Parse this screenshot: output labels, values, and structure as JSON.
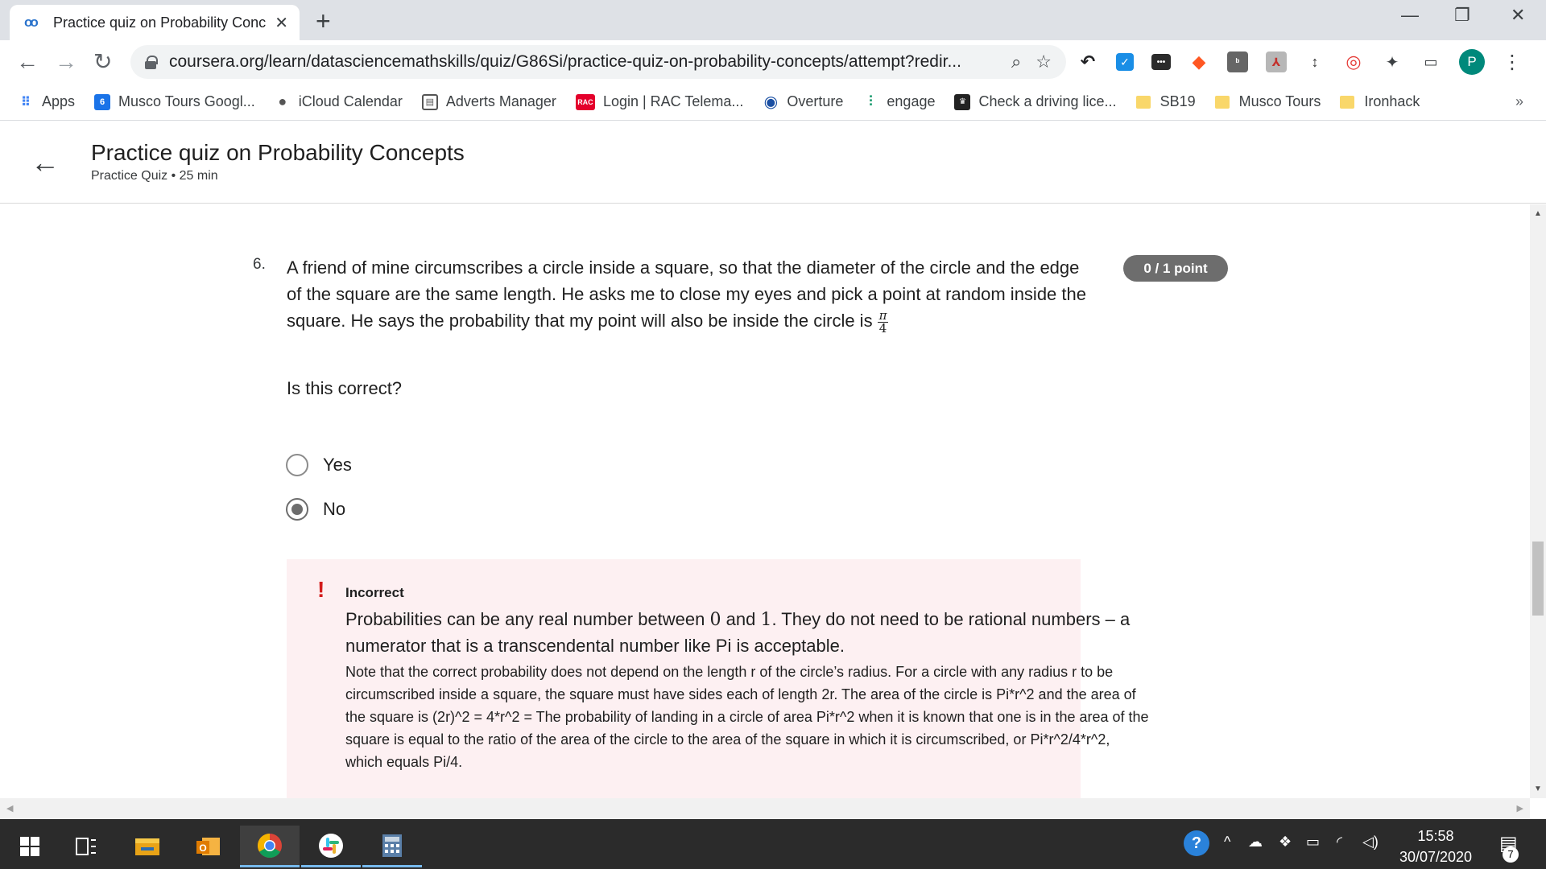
{
  "browser": {
    "tab_title": "Practice quiz on Probability Conc",
    "url": "coursera.org/learn/datasciencemathskills/quiz/G86Si/practice-quiz-on-probability-concepts/attempt?redir...",
    "profile_initial": "P"
  },
  "bookmarks": [
    {
      "label": "Apps",
      "icon": "apps-grid-icon"
    },
    {
      "label": "Musco Tours Googl...",
      "icon": "google-calendar-icon",
      "badge": "6"
    },
    {
      "label": "iCloud Calendar",
      "icon": "apple-icon"
    },
    {
      "label": "Adverts Manager",
      "icon": "adverts-icon"
    },
    {
      "label": "Login | RAC Telema...",
      "icon": "rac-icon",
      "badge": "RAC"
    },
    {
      "label": "Overture",
      "icon": "overture-icon"
    },
    {
      "label": "engage",
      "icon": "engage-icon"
    },
    {
      "label": "Check a driving lice...",
      "icon": "dvla-icon"
    },
    {
      "label": "SB19",
      "icon": "folder-icon"
    },
    {
      "label": "Musco Tours",
      "icon": "folder-icon"
    },
    {
      "label": "Ironhack",
      "icon": "folder-icon"
    }
  ],
  "bookmarks_more": "»",
  "page": {
    "title": "Practice quiz on Probability Concepts",
    "subtitle": "Practice Quiz • 25 min"
  },
  "question": {
    "number": "6.",
    "text": "A friend of mine circumscribes a circle inside a square, so that the diameter of the circle and the edge of the square are the same length. He asks me to close my eyes and pick a point at random inside the square. He says the probability that my point will also be inside the circle is",
    "fraction_num": "π",
    "fraction_den": "4",
    "points": "0 / 1 point",
    "followup": "Is this correct?",
    "options": [
      {
        "label": "Yes",
        "selected": false
      },
      {
        "label": "No",
        "selected": true
      }
    ]
  },
  "feedback": {
    "status": "Incorrect",
    "main_1": "Probabilities can be any real number between ",
    "main_zero": "0",
    "main_and": " and ",
    "main_one": "1",
    "main_2": ". They do not need to be rational numbers – a numerator that is a transcendental number like Pi is acceptable.",
    "note": "Note that the correct probability does not depend on the length r of the circle’s radius. For a circle with any radius r to be circumscribed inside a square, the square must have sides each of length 2r. The area of the circle is Pi*r^2 and the area of the square is (2r)^2 = 4*r^2 = The probability of landing in a circle of area Pi*r^2 when it is known that one is in the area of the square is equal to the ratio of the area of the circle to the area of the square in which it is circumscribed, or Pi*r^2/4*r^2, which equals Pi/4."
  },
  "taskbar": {
    "time": "15:58",
    "date": "30/07/2020",
    "notification_count": "7"
  },
  "colors": {
    "badge_gray": "#6d6d6d",
    "incorrect_red": "#d31b1b",
    "feedback_bg": "#fdf0f2",
    "profile_teal": "#00897b"
  }
}
